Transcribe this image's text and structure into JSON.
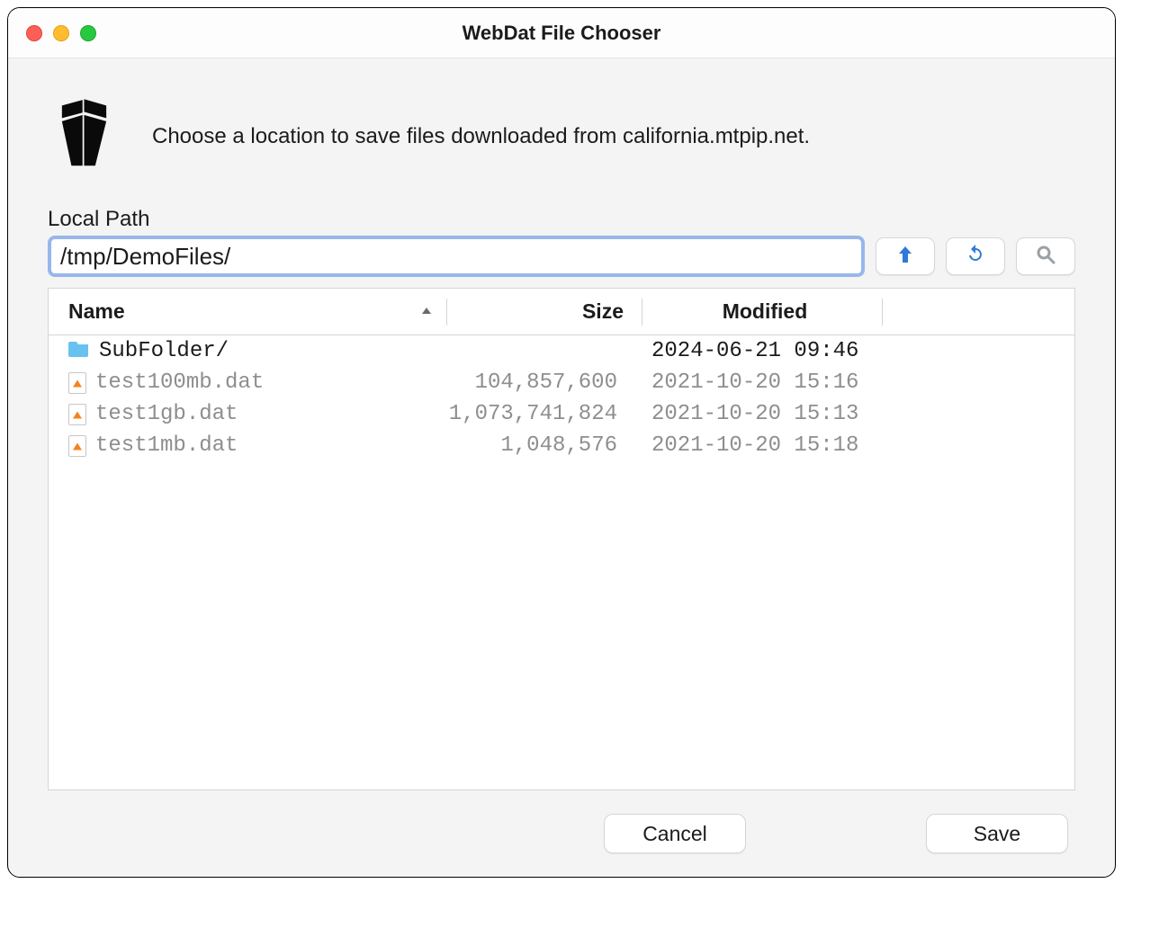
{
  "window": {
    "title": "WebDat File Chooser"
  },
  "intro": {
    "text": "Choose a location to save files downloaded from california.mtpip.net."
  },
  "path": {
    "label": "Local Path",
    "value": "/tmp/DemoFiles/"
  },
  "toolbar": {
    "up_icon": "arrow-up-icon",
    "refresh_icon": "refresh-icon",
    "search_icon": "search-icon"
  },
  "columns": {
    "name": "Name",
    "size": "Size",
    "modified": "Modified"
  },
  "sort": {
    "column": "name",
    "direction": "asc"
  },
  "rows": [
    {
      "type": "folder",
      "name": "SubFolder/",
      "size": "",
      "modified": "2024-06-21 09:46"
    },
    {
      "type": "file",
      "name": "test100mb.dat",
      "size": "104,857,600",
      "modified": "2021-10-20 15:16"
    },
    {
      "type": "file",
      "name": "test1gb.dat",
      "size": "1,073,741,824",
      "modified": "2021-10-20 15:13"
    },
    {
      "type": "file",
      "name": "test1mb.dat",
      "size": "1,048,576",
      "modified": "2021-10-20 15:18"
    }
  ],
  "buttons": {
    "cancel": "Cancel",
    "save": "Save"
  }
}
